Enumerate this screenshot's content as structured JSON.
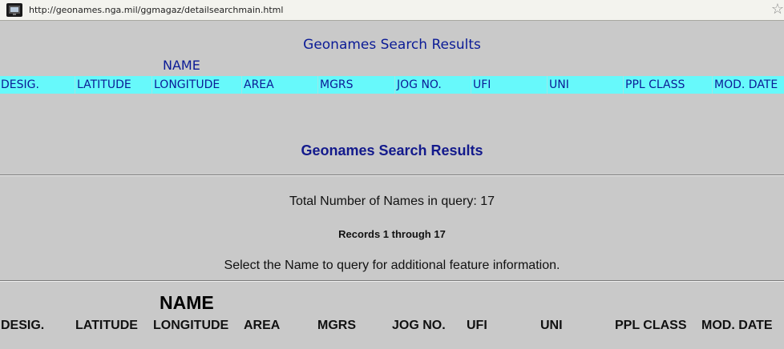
{
  "browser": {
    "url": "http://geonames.nga.mil/ggmagaz/detailsearchmain.html",
    "page_icon": "page-thumbnail-icon",
    "bookmark_icon": "star-icon"
  },
  "top_frame": {
    "title": "Geonames Search Results",
    "name_label": "NAME",
    "header_bg": "#67f9fb",
    "text_color": "#0b1b96",
    "columns": [
      "DESIG.",
      "LATITUDE",
      "LONGITUDE",
      "AREA",
      "MGRS",
      "JOG NO.",
      "UFI",
      "UNI",
      "PPL CLASS",
      "MOD. DATE"
    ]
  },
  "main": {
    "title": "Geonames Search Results",
    "total_names": "Total Number of Names in query: 17",
    "records": "Records 1 through 17",
    "instruction": "Select the Name to query for additional feature information.",
    "name_label": "NAME",
    "columns": [
      "DESIG.",
      "LATITUDE",
      "LONGITUDE",
      "AREA",
      "MGRS",
      "JOG NO.",
      "UFI",
      "UNI",
      "PPL CLASS",
      "MOD. DATE"
    ]
  }
}
